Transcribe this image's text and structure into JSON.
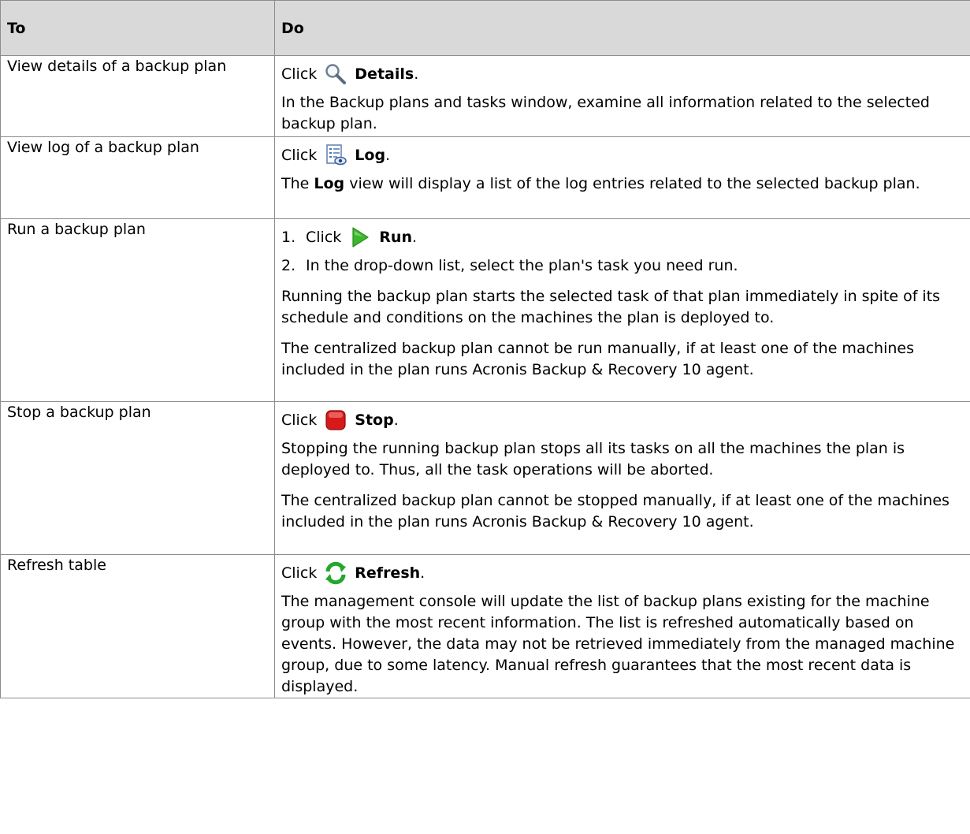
{
  "header": {
    "col_to": "To",
    "col_do": "Do"
  },
  "rows": [
    {
      "to": "View details of a backup plan",
      "click": "Click",
      "button": "Details",
      "suffix": ".",
      "paras": [
        "In the Backup plans and tasks window, examine all information related to the selected backup plan."
      ]
    },
    {
      "to": "View log of a backup plan",
      "click": "Click",
      "button": "Log",
      "suffix": ".",
      "para_bold": "Log",
      "para_rest": " view will display a list of the log entries related to the selected backup plan.",
      "para_pre": "The "
    },
    {
      "to": "Run a backup plan",
      "num1": "1.",
      "click": "Click",
      "button": "Run",
      "suffix": ".",
      "num2": "2.",
      "step2": "In the drop-down list, select the plan's task you need run.",
      "paras": [
        "Running the backup plan starts the selected task of that plan immediately in spite of its schedule and conditions on the machines the plan is deployed to.",
        "The centralized backup plan cannot be run manually, if at least one of the machines included in the plan runs Acronis Backup & Recovery 10 agent."
      ]
    },
    {
      "to": "Stop a backup plan",
      "click": "Click",
      "button": "Stop",
      "suffix": ".",
      "paras": [
        "Stopping the running backup plan stops all its tasks on all the machines the plan is deployed to. Thus, all the task operations will be aborted.",
        "The centralized backup plan cannot be stopped manually, if at least one of the machines included in the plan runs Acronis Backup & Recovery 10 agent."
      ]
    },
    {
      "to": "Refresh table",
      "click": "Click",
      "button": "Refresh",
      "suffix": ".",
      "paras": [
        "The management console will update the list of backup plans existing for the machine group with the most recent information. The list is refreshed automatically based on events. However, the data may not be retrieved immediately from the managed machine group, due to some latency. Manual refresh guarantees that the most recent data is displayed."
      ]
    }
  ],
  "icons": {
    "details": "magnifier-icon",
    "log": "log-document-icon",
    "run": "green-play-icon",
    "stop": "red-stop-icon",
    "refresh": "green-refresh-icon"
  },
  "colors": {
    "header_bg": "#d9d9d9",
    "border": "#8c8c8c",
    "run": "#3bb82b",
    "stop": "#d61a1a",
    "refresh": "#22a82c"
  }
}
